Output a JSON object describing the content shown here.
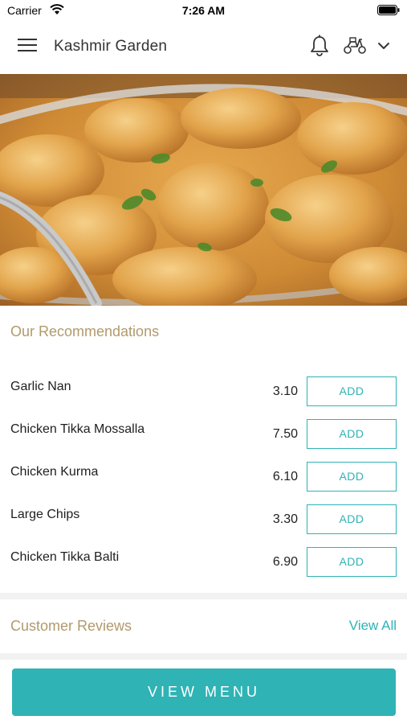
{
  "status_bar": {
    "carrier": "Carrier",
    "time": "7:26 AM"
  },
  "header": {
    "title": "Kashmir Garden"
  },
  "hero": {
    "image": "chicken-curry-dish"
  },
  "recommendations": {
    "title": "Our Recommendations",
    "add_label": "ADD",
    "items": [
      {
        "name": "Garlic Nan",
        "price": "3.10"
      },
      {
        "name": "Chicken Tikka Mossalla",
        "price": "7.50"
      },
      {
        "name": "Chicken Kurma",
        "price": "6.10"
      },
      {
        "name": "Large Chips",
        "price": "3.30"
      },
      {
        "name": "Chicken Tikka Balti",
        "price": "6.90"
      }
    ]
  },
  "reviews": {
    "title": "Customer Reviews",
    "view_all": "View All"
  },
  "footer": {
    "view_menu": "VIEW MENU"
  },
  "colors": {
    "accent": "#2fb3b5",
    "section_title": "#b19a6c"
  }
}
